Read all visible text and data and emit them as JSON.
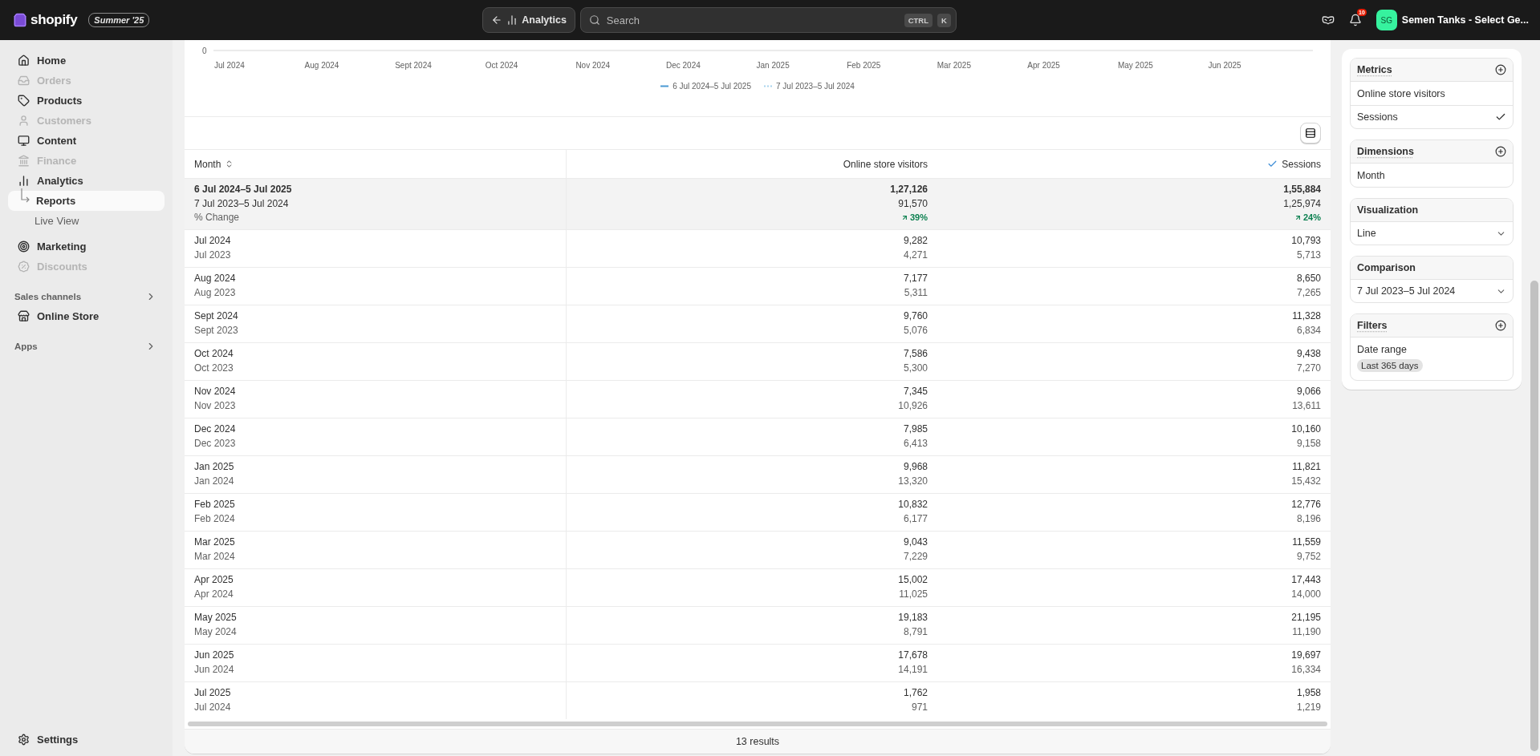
{
  "top_bar": {
    "logo": "shopify",
    "edition_badge": "Summer '25",
    "back_button": "Analytics",
    "search": {
      "placeholder": "Search",
      "shortcut_keys": [
        "CTRL",
        "K"
      ]
    },
    "notification_count": "10",
    "store": {
      "initials": "SG",
      "name": "Semen Tanks - Select Ge..."
    }
  },
  "sidebar": {
    "items": [
      {
        "label": "Home",
        "disabled": false,
        "selected": false
      },
      {
        "label": "Orders",
        "disabled": true,
        "selected": false
      },
      {
        "label": "Products",
        "disabled": false,
        "selected": false
      },
      {
        "label": "Customers",
        "disabled": true,
        "selected": false
      },
      {
        "label": "Content",
        "disabled": false,
        "selected": false
      },
      {
        "label": "Finance",
        "disabled": true,
        "selected": false
      },
      {
        "label": "Analytics",
        "disabled": false,
        "selected": false,
        "children": [
          {
            "label": "Reports",
            "selected": true
          },
          {
            "label": "Live View",
            "selected": false
          }
        ]
      },
      {
        "label": "Marketing",
        "disabled": false,
        "selected": false
      },
      {
        "label": "Discounts",
        "disabled": true,
        "selected": false
      }
    ],
    "sections": [
      {
        "title": "Sales channels",
        "items": [
          {
            "label": "Online Store",
            "selected": false
          }
        ]
      },
      {
        "title": "Apps"
      }
    ],
    "settings": "Settings"
  },
  "chart": {
    "y_tick": "0",
    "x_labels": [
      "Jul 2024",
      "Aug 2024",
      "Sept 2024",
      "Oct 2024",
      "Nov 2024",
      "Dec 2024",
      "Jan 2025",
      "Feb 2025",
      "Mar 2025",
      "Apr 2025",
      "May 2025",
      "Jun 2025"
    ],
    "legend": [
      {
        "label": "6 Jul 2024–5 Jul 2025",
        "color": "#4a9ad4",
        "kind": "solid"
      },
      {
        "label": "7 Jul 2023–5 Jul 2024",
        "color": "#a8d4ee",
        "kind": "dotted"
      }
    ]
  },
  "table": {
    "columns": [
      {
        "label": "Month",
        "kind": "dimension",
        "checked": false
      },
      {
        "label": "Online store visitors",
        "kind": "metric",
        "checked": false
      },
      {
        "label": "Sessions",
        "kind": "metric",
        "checked": true
      }
    ],
    "summary": {
      "period": "6 Jul 2024–5 Jul 2025",
      "comparison": "7 Jul 2023–5 Jul 2024",
      "change_label": "% Change",
      "values": [
        {
          "current": "1,27,126",
          "previous": "91,570",
          "change": "39%"
        },
        {
          "current": "1,55,884",
          "previous": "1,25,974",
          "change": "24%"
        }
      ]
    },
    "rows": [
      {
        "month": "Jul 2024",
        "prev_month": "Jul 2023",
        "values": [
          [
            "9,282",
            "4,271"
          ],
          [
            "10,793",
            "5,713"
          ]
        ]
      },
      {
        "month": "Aug 2024",
        "prev_month": "Aug 2023",
        "values": [
          [
            "7,177",
            "5,311"
          ],
          [
            "8,650",
            "7,265"
          ]
        ]
      },
      {
        "month": "Sept 2024",
        "prev_month": "Sept 2023",
        "values": [
          [
            "9,760",
            "5,076"
          ],
          [
            "11,328",
            "6,834"
          ]
        ]
      },
      {
        "month": "Oct 2024",
        "prev_month": "Oct 2023",
        "values": [
          [
            "7,586",
            "5,300"
          ],
          [
            "9,438",
            "7,270"
          ]
        ]
      },
      {
        "month": "Nov 2024",
        "prev_month": "Nov 2023",
        "values": [
          [
            "7,345",
            "10,926"
          ],
          [
            "9,066",
            "13,611"
          ]
        ]
      },
      {
        "month": "Dec 2024",
        "prev_month": "Dec 2023",
        "values": [
          [
            "7,985",
            "6,413"
          ],
          [
            "10,160",
            "9,158"
          ]
        ]
      },
      {
        "month": "Jan 2025",
        "prev_month": "Jan 2024",
        "values": [
          [
            "9,968",
            "13,320"
          ],
          [
            "11,821",
            "15,432"
          ]
        ]
      },
      {
        "month": "Feb 2025",
        "prev_month": "Feb 2024",
        "values": [
          [
            "10,832",
            "6,177"
          ],
          [
            "12,776",
            "8,196"
          ]
        ]
      },
      {
        "month": "Mar 2025",
        "prev_month": "Mar 2024",
        "values": [
          [
            "9,043",
            "7,229"
          ],
          [
            "11,559",
            "9,752"
          ]
        ]
      },
      {
        "month": "Apr 2025",
        "prev_month": "Apr 2024",
        "values": [
          [
            "15,002",
            "11,025"
          ],
          [
            "17,443",
            "14,000"
          ]
        ]
      },
      {
        "month": "May 2025",
        "prev_month": "May 2024",
        "values": [
          [
            "19,183",
            "8,791"
          ],
          [
            "21,195",
            "11,190"
          ]
        ]
      },
      {
        "month": "Jun 2025",
        "prev_month": "Jun 2024",
        "values": [
          [
            "17,678",
            "14,191"
          ],
          [
            "19,697",
            "16,334"
          ]
        ]
      },
      {
        "month": "Jul 2025",
        "prev_month": "Jul 2024",
        "values": [
          [
            "1,762",
            "971"
          ],
          [
            "1,958",
            "1,219"
          ]
        ]
      }
    ],
    "footer": "13 results"
  },
  "panel": {
    "sections": [
      {
        "title": "Metrics",
        "kind": "list",
        "items": [
          {
            "label": "Online store visitors",
            "selected": false
          },
          {
            "label": "Sessions",
            "selected": true
          }
        ]
      },
      {
        "title": "Dimensions",
        "kind": "list",
        "items": [
          {
            "label": "Month",
            "selected": false
          }
        ]
      },
      {
        "title": "Visualization",
        "kind": "select",
        "value": "Line"
      },
      {
        "title": "Comparison",
        "kind": "select",
        "value": "7 Jul 2023–5 Jul 2024"
      },
      {
        "title": "Filters",
        "kind": "filter",
        "label": "Date range",
        "tag": "Last 365 days"
      }
    ]
  }
}
